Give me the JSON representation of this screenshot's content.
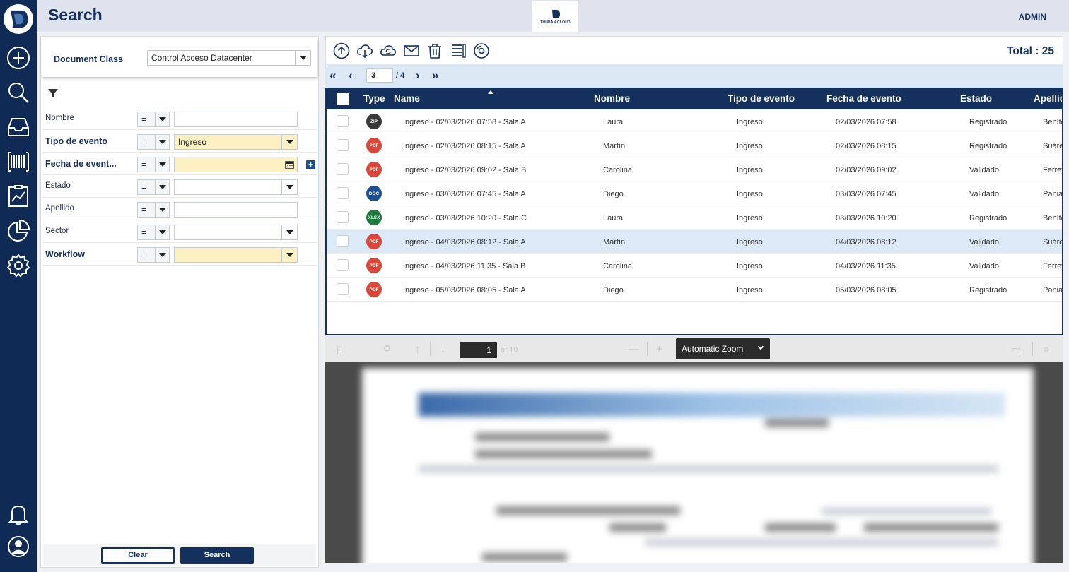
{
  "header": {
    "title": "Search",
    "brand": "THUBAN CLOUD",
    "user": "ADMIN"
  },
  "document_class": {
    "label": "Document Class",
    "value": "Control Acceso Datacenter"
  },
  "filters": [
    {
      "label": "Nombre",
      "operator": "=",
      "value": "",
      "bold": false,
      "type": "text"
    },
    {
      "label": "Tipo de evento",
      "operator": "=",
      "value": "Ingreso",
      "bold": true,
      "type": "select",
      "required": true
    },
    {
      "label": "Fecha de event...",
      "operator": "=",
      "value": "",
      "bold": true,
      "type": "date",
      "required": true
    },
    {
      "label": "Estado",
      "operator": "=",
      "value": "",
      "bold": false,
      "type": "select"
    },
    {
      "label": "Apellido",
      "operator": "=",
      "value": "",
      "bold": false,
      "type": "text"
    },
    {
      "label": "Sector",
      "operator": "=",
      "value": "",
      "bold": false,
      "type": "select"
    },
    {
      "label": "Workflow",
      "operator": "=",
      "value": "",
      "bold": true,
      "type": "select",
      "required": true
    }
  ],
  "buttons": {
    "clear": "Clear",
    "search": "Search"
  },
  "toolbar": {
    "icons": [
      "upload-icon",
      "cloud-download-icon",
      "cloud-sync-icon",
      "mail-icon",
      "trash-icon",
      "list-edit-icon",
      "disc-icon"
    ],
    "total_label": "Total : 25"
  },
  "pager": {
    "current": "3",
    "total": "/ 4"
  },
  "grid": {
    "columns": [
      "Type",
      "Name",
      "Nombre",
      "Tipo de evento",
      "Fecha de evento",
      "Estado",
      "Apellido"
    ],
    "rows": [
      {
        "type": "ZIP",
        "name": "Ingreso - 02/03/2026 07:58 - Sala A",
        "nombre": "Laura",
        "tipo": "Ingreso",
        "fecha": "02/03/2026 07:58",
        "estado": "Registrado",
        "apellido": "Benítez"
      },
      {
        "type": "PDF",
        "name": "Ingreso - 02/03/2026 08:15 - Sala A",
        "nombre": "Martín",
        "tipo": "Ingreso",
        "fecha": "02/03/2026 08:15",
        "estado": "Registrado",
        "apellido": "Suárez"
      },
      {
        "type": "PDF",
        "name": "Ingreso - 02/03/2026 09:02 - Sala B",
        "nombre": "Carolina",
        "tipo": "Ingreso",
        "fecha": "02/03/2026 09:02",
        "estado": "Validado",
        "apellido": "Ferreyra"
      },
      {
        "type": "DOC",
        "name": "Ingreso - 03/03/2026 07:45 - Sala A",
        "nombre": "Diego",
        "tipo": "Ingreso",
        "fecha": "03/03/2026 07:45",
        "estado": "Validado",
        "apellido": "Paniagua"
      },
      {
        "type": "XLSX",
        "name": "Ingreso - 03/03/2026 10:20 - Sala C",
        "nombre": "Laura",
        "tipo": "Ingreso",
        "fecha": "03/03/2026 10:20",
        "estado": "Registrado",
        "apellido": "Benítez"
      },
      {
        "type": "PDF",
        "name": "Ingreso - 04/03/2026 08:12 - Sala A",
        "nombre": "Martín",
        "tipo": "Ingreso",
        "fecha": "04/03/2026 08:12",
        "estado": "Validado",
        "apellido": "Suárez",
        "selected": true
      },
      {
        "type": "PDF",
        "name": "Ingreso - 04/03/2026 11:35 - Sala B",
        "nombre": "Carolina",
        "tipo": "Ingreso",
        "fecha": "04/03/2026 11:35",
        "estado": "Validado",
        "apellido": "Ferreyra"
      },
      {
        "type": "PDF",
        "name": "Ingreso - 05/03/2026 08:05 - Sala A",
        "nombre": "Diego",
        "tipo": "Ingreso",
        "fecha": "05/03/2026 08:05",
        "estado": "Registrado",
        "apellido": "Paniagua"
      }
    ]
  },
  "file_type_colors": {
    "ZIP": "#3a3a3a",
    "PDF": "#d9463a",
    "DOC": "#1d4f8e",
    "XLSX": "#1e7a3f"
  },
  "pdf_viewer": {
    "page_number": "1",
    "page_count": "of 19",
    "zoom": "Automatic Zoom"
  },
  "colors": {
    "brand": "#14305d",
    "selected_row": "#dce9f7",
    "required_field": "#fdf1c4"
  }
}
